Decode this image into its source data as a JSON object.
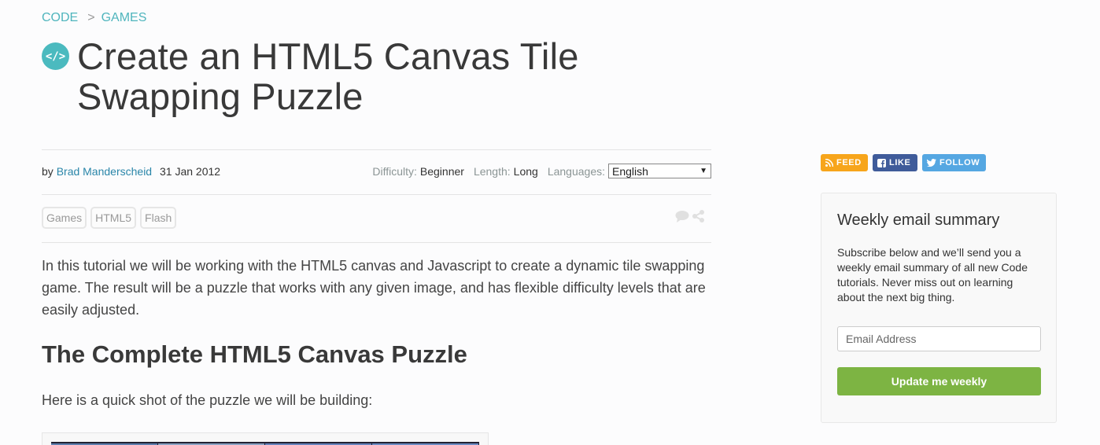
{
  "breadcrumb": [
    {
      "label": "CODE"
    },
    {
      "separator": ">",
      "label": "GAMES"
    }
  ],
  "title_icon": "code-brackets-icon",
  "title_icon_glyph": "</>",
  "page_title": "Create an HTML5 Canvas Tile Swapping Puzzle",
  "meta": {
    "by_label": "by",
    "author": "Brad Manderscheid",
    "date": "31 Jan 2012",
    "difficulty_label": "Difficulty:",
    "difficulty": "Beginner",
    "length_label": "Length:",
    "length": "Long",
    "languages_label": "Languages:",
    "language_selected": "English"
  },
  "tags": [
    "Games",
    "HTML5",
    "Flash"
  ],
  "social_icons": [
    "comment-icon",
    "share-icon"
  ],
  "article": {
    "intro": "In this tutorial we will be working with the HTML5 canvas and Javascript to create a dynamic tile swapping game. The result will be a puzzle that works with any given image, and has flexible difficulty levels that are easily adjusted.",
    "heading": "The Complete HTML5 Canvas Puzzle",
    "paragraph2": "Here is a quick shot of the puzzle we will be building:"
  },
  "follow": {
    "feed": "FEED",
    "like": "LIKE",
    "follow": "FOLLOW",
    "colors": {
      "feed": "#f7a51b",
      "like": "#3f5b9a",
      "follow": "#55a7e2"
    }
  },
  "signup": {
    "heading": "Weekly email summary",
    "description": "Subscribe below and we’ll send you a weekly email summary of all new Code tutorials. Never miss out on learning about the next big thing.",
    "email_placeholder": "Email Address",
    "button": "Update me weekly",
    "button_color": "#7db443"
  }
}
